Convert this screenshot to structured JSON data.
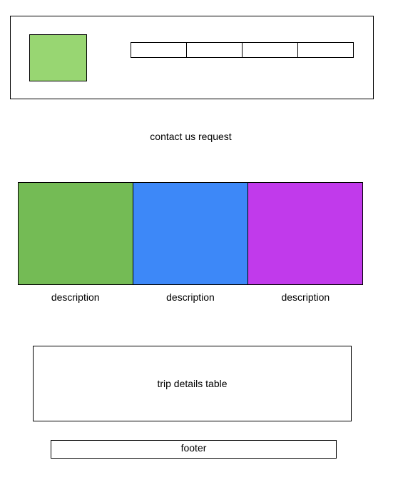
{
  "colors": {
    "logo": "#98d672",
    "card_green": "#74bb55",
    "card_blue": "#3d88f8",
    "card_purple": "#c13aeb"
  },
  "header": {
    "nav_items": [
      "",
      "",
      "",
      ""
    ]
  },
  "contact": {
    "text": "contact us request"
  },
  "cards": [
    {
      "description": "description"
    },
    {
      "description": "description"
    },
    {
      "description": "description"
    }
  ],
  "trip_table": {
    "text": "trip details table"
  },
  "footer": {
    "text": "footer"
  }
}
